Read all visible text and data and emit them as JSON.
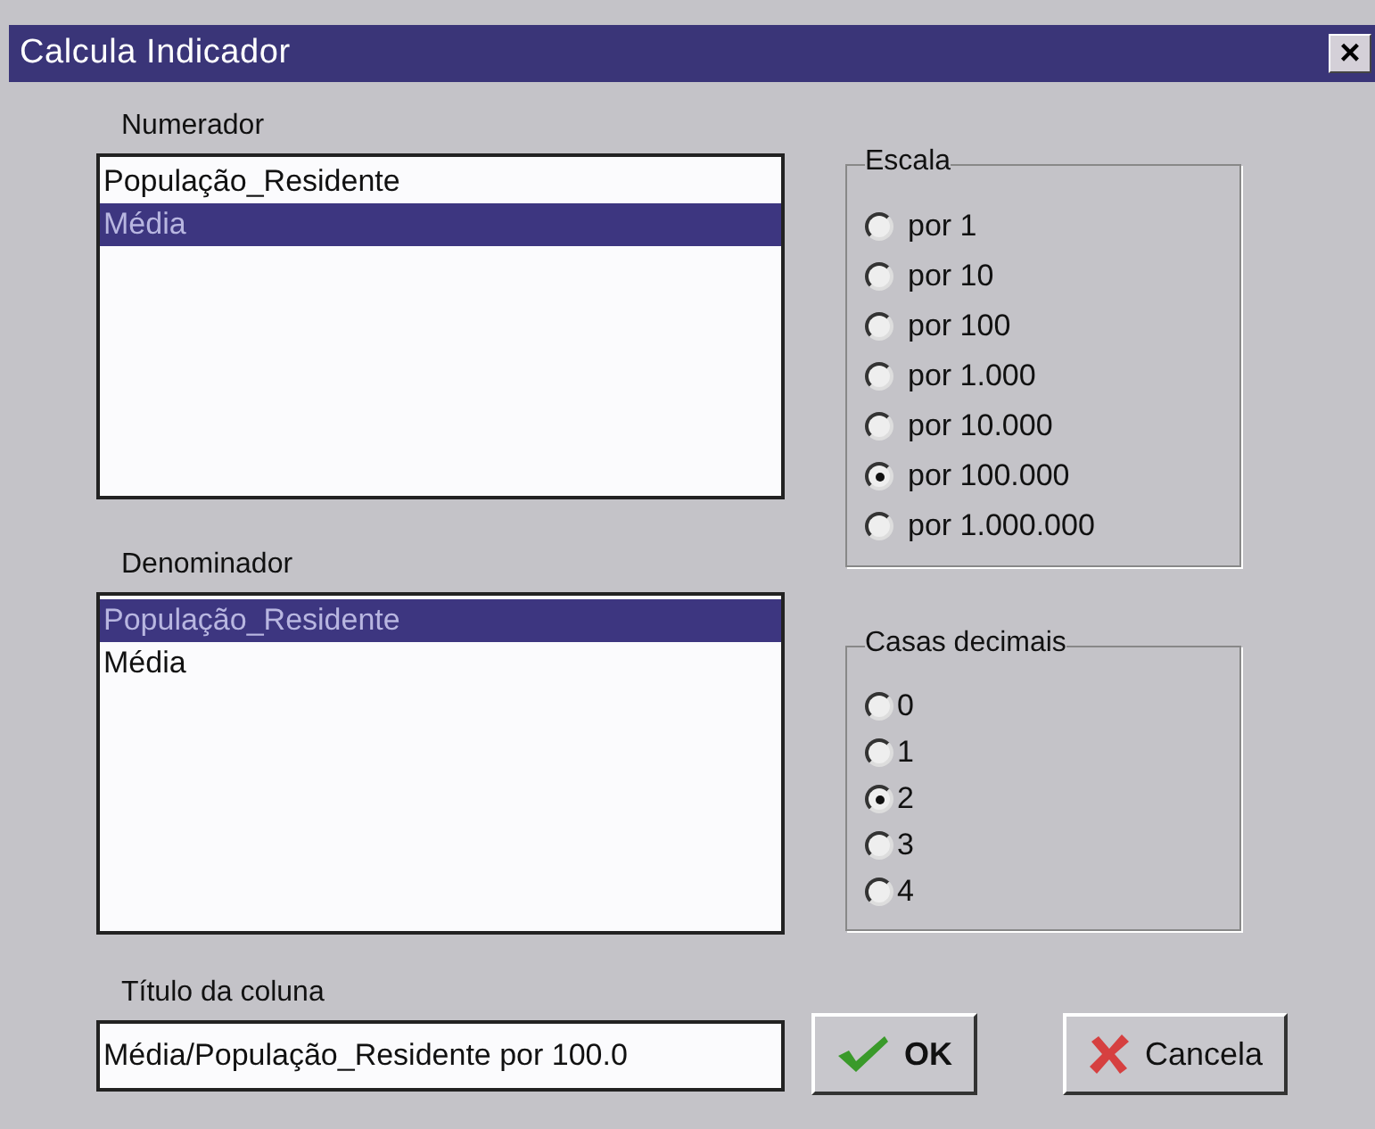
{
  "window": {
    "title": "Calcula Indicador",
    "close": "×"
  },
  "numerador": {
    "label": "Numerador",
    "items": [
      {
        "text": "População_Residente",
        "selected": false
      },
      {
        "text": "Média",
        "selected": true
      }
    ]
  },
  "denominador": {
    "label": "Denominador",
    "items": [
      {
        "text": "População_Residente",
        "selected": true
      },
      {
        "text": "Média",
        "selected": false
      }
    ]
  },
  "titulo": {
    "label": "Título da coluna",
    "value": "Média/População_Residente por 100.0"
  },
  "escala": {
    "label": "Escala",
    "options": [
      {
        "text": "por 1",
        "selected": false
      },
      {
        "text": "por 10",
        "selected": false
      },
      {
        "text": "por 100",
        "selected": false
      },
      {
        "text": "por 1.000",
        "selected": false
      },
      {
        "text": "por 10.000",
        "selected": false
      },
      {
        "text": "por 100.000",
        "selected": true
      },
      {
        "text": "por 1.000.000",
        "selected": false
      }
    ]
  },
  "casas": {
    "label": "Casas decimais",
    "options": [
      {
        "text": "0",
        "selected": false
      },
      {
        "text": "1",
        "selected": false
      },
      {
        "text": "2",
        "selected": true
      },
      {
        "text": "3",
        "selected": false
      },
      {
        "text": "4",
        "selected": false
      }
    ]
  },
  "buttons": [
    {
      "kind": "ok",
      "label": "OK"
    },
    {
      "kind": "cancel",
      "label": "Cancela"
    }
  ]
}
